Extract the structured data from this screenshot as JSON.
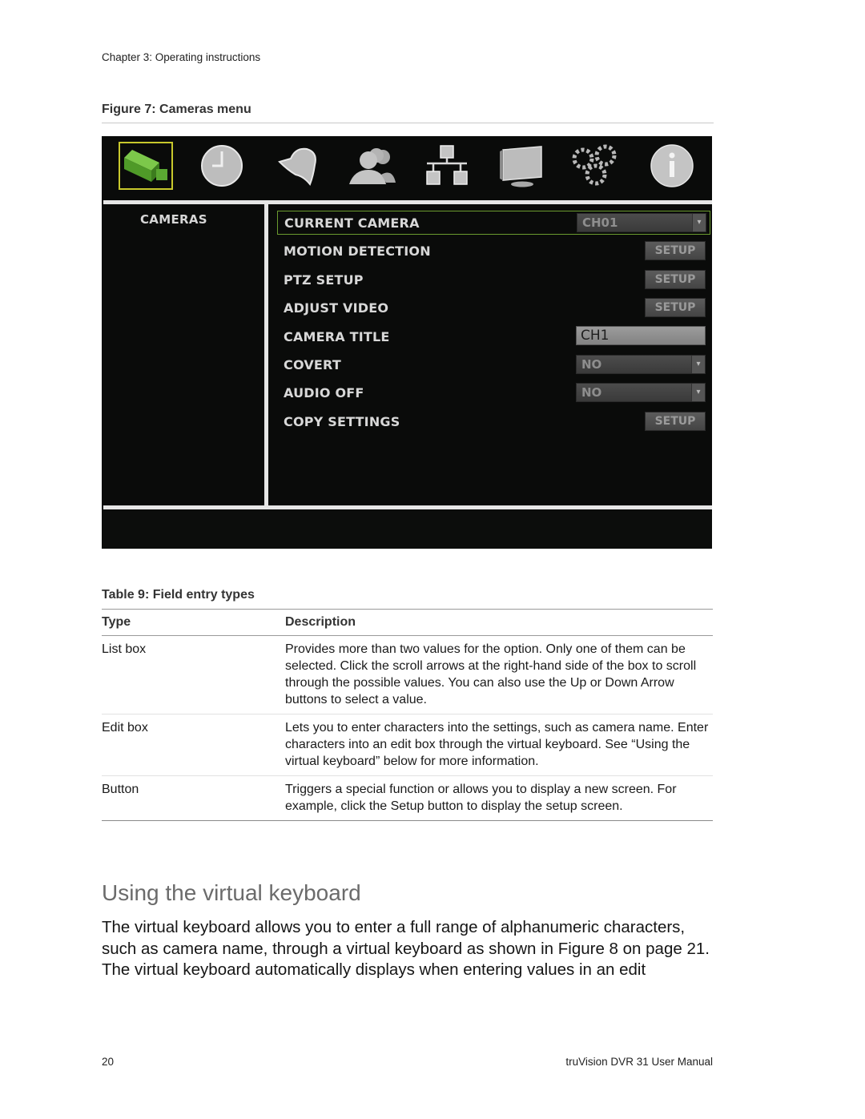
{
  "header": {
    "running_head": "Chapter 3: Operating instructions"
  },
  "figure": {
    "caption": "Figure 7: Cameras menu",
    "dvr_menu": {
      "icons": [
        {
          "name": "camera-icon",
          "selected": true
        },
        {
          "name": "clock-icon",
          "selected": false
        },
        {
          "name": "alarm-bell-icon",
          "selected": false
        },
        {
          "name": "users-icon",
          "selected": false
        },
        {
          "name": "network-icon",
          "selected": false
        },
        {
          "name": "monitor-icon",
          "selected": false
        },
        {
          "name": "gears-icon",
          "selected": false
        },
        {
          "name": "info-icon",
          "selected": false
        }
      ],
      "colors": {
        "selected_outline": "#c8c82c",
        "focus_border": "#6b9b2f",
        "camera_green": "#5aa832"
      },
      "sidebar_title": "CAMERAS",
      "rows": [
        {
          "label": "CURRENT CAMERA",
          "control": "select",
          "value": "CH01",
          "focused": true
        },
        {
          "label": "MOTION DETECTION",
          "control": "button",
          "value": "SETUP"
        },
        {
          "label": "PTZ SETUP",
          "control": "button",
          "value": "SETUP"
        },
        {
          "label": "ADJUST VIDEO",
          "control": "button",
          "value": "SETUP"
        },
        {
          "label": "CAMERA TITLE",
          "control": "edit",
          "value": "CH1"
        },
        {
          "label": "COVERT",
          "control": "select",
          "value": "NO"
        },
        {
          "label": "AUDIO OFF",
          "control": "select",
          "value": "NO"
        },
        {
          "label": "COPY SETTINGS",
          "control": "button",
          "value": "SETUP"
        }
      ],
      "dropdown_arrow": "▾"
    }
  },
  "table": {
    "caption": "Table 9: Field entry types",
    "headers": [
      "Type",
      "Description"
    ],
    "rows": [
      {
        "type": "List box",
        "description": "Provides more than two values for the option. Only one of them can be selected. Click the scroll arrows at the right-hand side of the box to scroll through the possible values. You can also use the Up or Down Arrow buttons to select a value."
      },
      {
        "type": "Edit box",
        "description": "Lets you to enter characters into the settings, such as camera name. Enter characters into an edit box through the virtual keyboard. See “Using the virtual keyboard” below for more information."
      },
      {
        "type": "Button",
        "description": "Triggers a special function or allows you to display a new screen. For example, click the Setup button to display the setup screen."
      }
    ]
  },
  "section": {
    "heading": "Using the virtual keyboard",
    "body": "The virtual keyboard allows you to enter a full range of alphanumeric characters, such as camera name, through a virtual keyboard as shown in Figure 8 on page 21. The virtual keyboard automatically displays when entering values in an edit"
  },
  "footer": {
    "page_number": "20",
    "manual_title": "truVision DVR 31 User Manual"
  }
}
